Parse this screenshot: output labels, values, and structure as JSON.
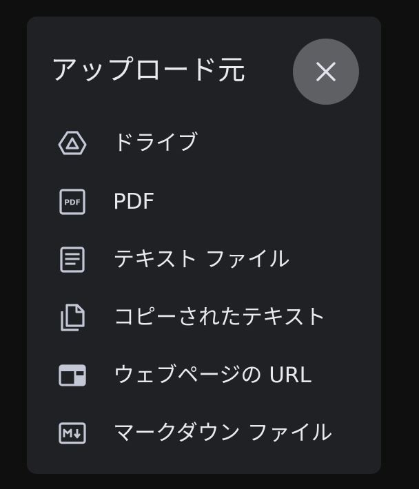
{
  "dialog": {
    "title": "アップロード元",
    "close_icon": "close-icon",
    "colors": {
      "background": "#202124",
      "text": "#e8eaed",
      "icon": "#c4c7d5",
      "close_button": "#5f6063"
    }
  },
  "items": [
    {
      "label": "ドライブ",
      "icon": "drive-icon"
    },
    {
      "label": "PDF",
      "icon": "pdf-icon"
    },
    {
      "label": "テキスト ファイル",
      "icon": "text-file-icon"
    },
    {
      "label": "コピーされたテキスト",
      "icon": "copy-icon"
    },
    {
      "label": "ウェブページの URL",
      "icon": "web-page-icon"
    },
    {
      "label": "マークダウン ファイル",
      "icon": "markdown-icon"
    }
  ]
}
